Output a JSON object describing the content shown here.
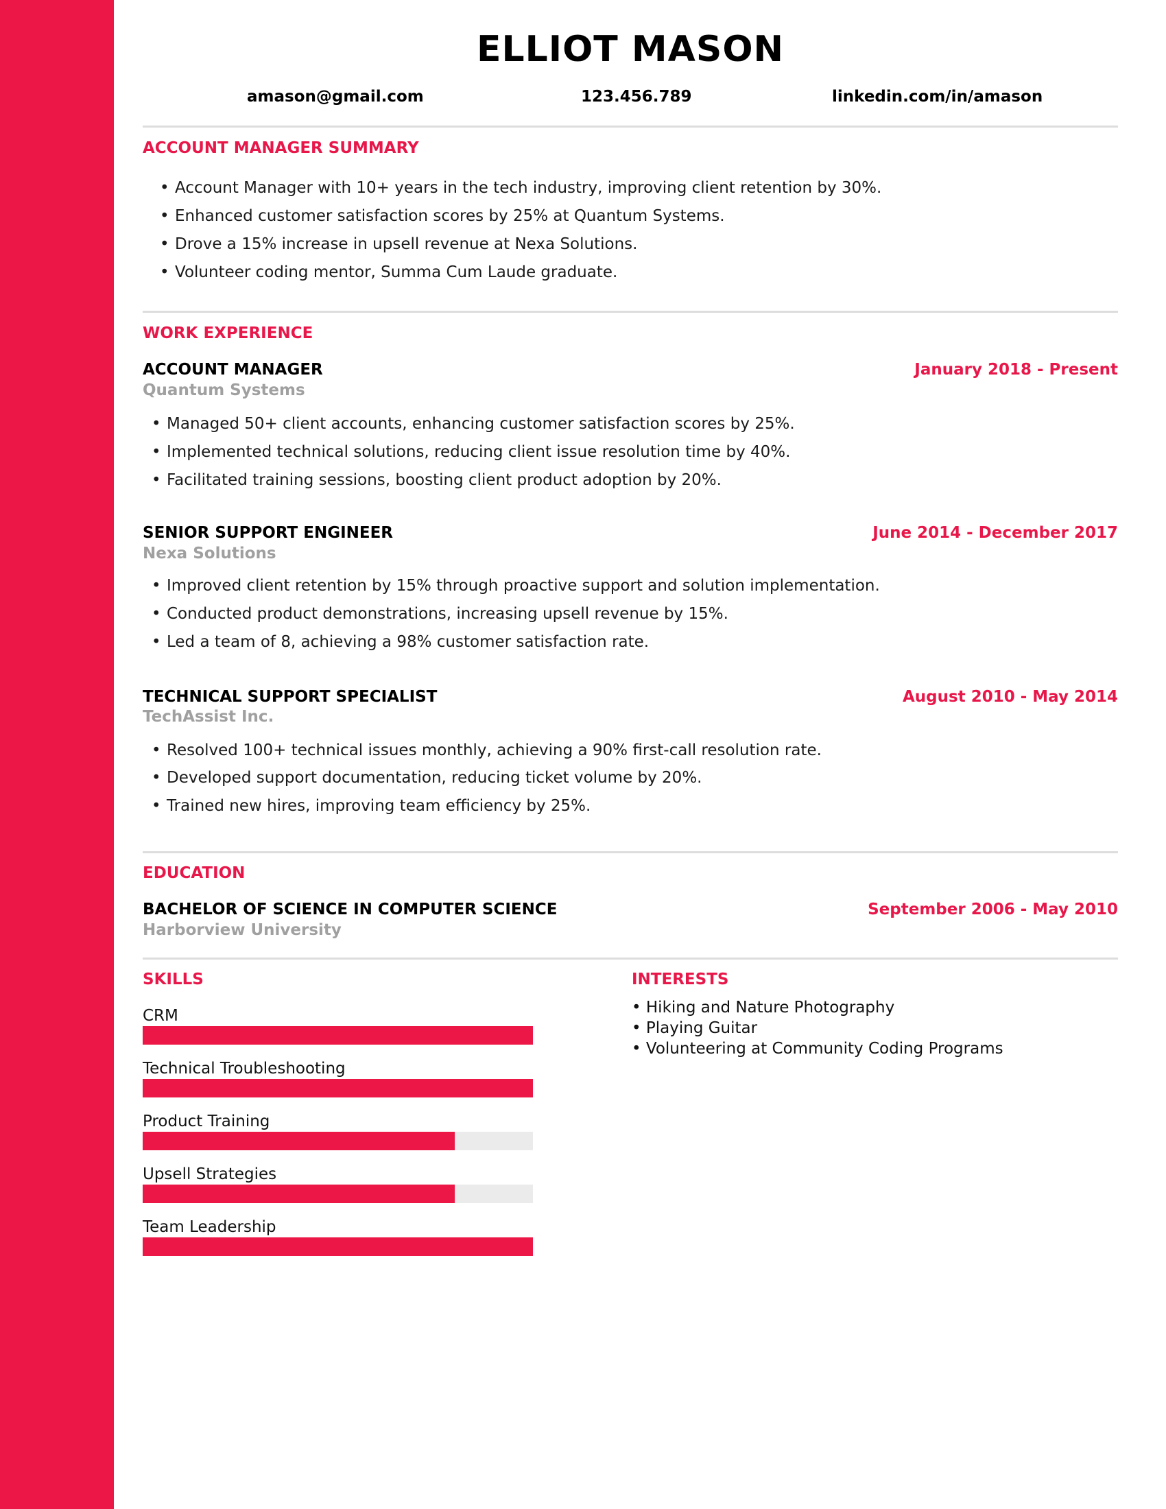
{
  "theme": {
    "accent": "#ec1746",
    "heading_color": "#e8174a",
    "muted": "#a0a0a0",
    "divider": "#dddddd",
    "bar_track": "#ebebeb"
  },
  "header": {
    "name": "ELLIOT MASON",
    "email": "amason@gmail.com",
    "phone": "123.456.789",
    "linkedin": "linkedin.com/in/amason"
  },
  "summary": {
    "heading": "ACCOUNT MANAGER  SUMMARY",
    "bullets": [
      "Account Manager with 10+ years in the tech industry, improving client retention by 30%.",
      "Enhanced customer satisfaction scores by 25% at Quantum Systems.",
      "Drove a 15% increase in upsell revenue at Nexa Solutions.",
      "Volunteer coding mentor, Summa Cum Laude graduate."
    ]
  },
  "work": {
    "heading": "WORK EXPERIENCE",
    "jobs": [
      {
        "title": "ACCOUNT MANAGER",
        "company": "Quantum Systems",
        "dates": "January 2018 - Present",
        "bullets": [
          "Managed 50+ client accounts, enhancing customer satisfaction scores by 25%.",
          "Implemented technical solutions, reducing client issue resolution time by 40%.",
          "Facilitated training sessions, boosting client product adoption by 20%."
        ]
      },
      {
        "title": "SENIOR SUPPORT ENGINEER",
        "company": "Nexa Solutions",
        "dates": "June 2014 - December 2017",
        "bullets": [
          "Improved client retention by 15% through proactive support and solution implementation.",
          "Conducted product demonstrations, increasing upsell revenue by 15%.",
          "Led a team of 8, achieving a 98% customer satisfaction rate."
        ]
      },
      {
        "title": "TECHNICAL SUPPORT SPECIALIST",
        "company": "TechAssist Inc.",
        "dates": "August 2010 - May 2014",
        "bullets": [
          "Resolved 100+ technical issues monthly, achieving a 90% first-call resolution rate.",
          "Developed support documentation, reducing ticket volume by 20%.",
          "Trained new hires, improving team efficiency by 25%."
        ]
      }
    ]
  },
  "education": {
    "heading": "EDUCATION",
    "degree": "BACHELOR OF SCIENCE IN COMPUTER SCIENCE",
    "school": "Harborview University",
    "dates": "September 2006 - May 2010"
  },
  "skills": {
    "heading": "SKILLS",
    "items": [
      {
        "label": "CRM",
        "level": 1.0
      },
      {
        "label": "Technical Troubleshooting",
        "level": 1.0
      },
      {
        "label": "Product Training",
        "level": 0.8
      },
      {
        "label": "Upsell Strategies",
        "level": 0.8
      },
      {
        "label": "Team Leadership",
        "level": 1.0
      }
    ]
  },
  "interests": {
    "heading": "INTERESTS",
    "bullet_char": "•",
    "items": [
      "Hiking and Nature Photography",
      "Playing Guitar",
      "Volunteering at Community Coding Programs"
    ]
  },
  "bullet_char": "•"
}
